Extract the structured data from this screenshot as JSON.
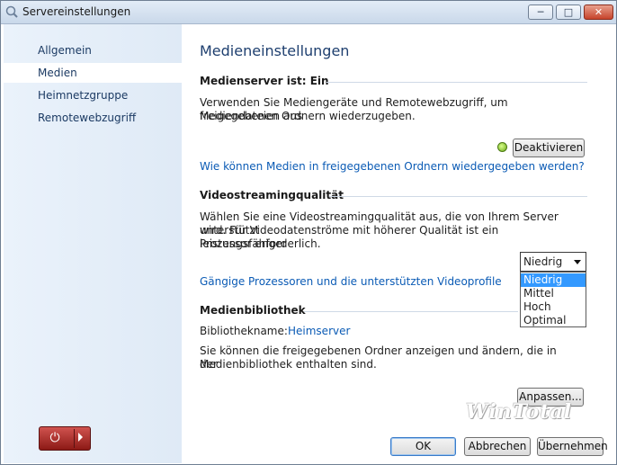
{
  "window": {
    "title": "Servereinstellungen"
  },
  "sidebar": {
    "items": [
      {
        "label": "Allgemein",
        "selected": false
      },
      {
        "label": "Medien",
        "selected": true
      },
      {
        "label": "Heimnetzgruppe",
        "selected": false
      },
      {
        "label": "Remotewebzugriff",
        "selected": false
      }
    ]
  },
  "content": {
    "heading": "Medieneinstellungen",
    "server": {
      "title": "Medienserver ist: Ein",
      "description_line1": "Verwenden Sie Mediengeräte und Remotewebzugriff, um Mediendateien aus",
      "description_line2": "freigegebenen Ordnern wiederzugeben.",
      "status_color": "#7bc21f",
      "deactivate_label": "Deaktivieren",
      "help_link": "Wie können Medien in freigegebenen Ordnern wiedergegeben werden?"
    },
    "streaming": {
      "title": "Videostreamingqualität",
      "description_line1": "Wählen Sie eine Videostreamingqualität aus, die von Ihrem Server unterstützt",
      "description_line2": "wird. Für Videodatenströme mit höherer Qualität ist ein leistungsfähiger",
      "description_line3": "Prozessor erforderlich.",
      "selected": "Niedrig",
      "options": [
        "Niedrig",
        "Mittel",
        "Hoch",
        "Optimal"
      ],
      "link": "Gängige Prozessoren und die unterstützten Videoprofile"
    },
    "library": {
      "title": "Medienbibliothek",
      "name_label": "Bibliothekname:",
      "name_value": "Heimserver",
      "description_line1": "Sie können die freigegebenen Ordner anzeigen und ändern, die in der",
      "description_line2": "Medienbibliothek enthalten sind.",
      "customize_label": "Anpassen..."
    },
    "watermark": "WinTotal"
  },
  "footer": {
    "ok_label": "OK",
    "cancel_label": "Abbrechen",
    "apply_label": "Übernehmen"
  },
  "colors": {
    "accent": "#1e3f6f",
    "link": "#0b5bb5",
    "selection": "#3399ff",
    "power": "#a82420"
  }
}
